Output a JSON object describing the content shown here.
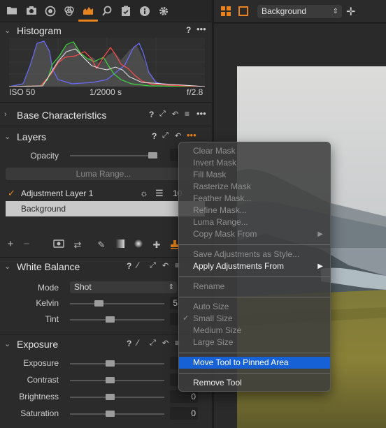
{
  "toolbar": {
    "icons": [
      "folder-icon",
      "camera-icon",
      "lens-icon",
      "color-icon",
      "exposure-icon",
      "details-icon",
      "metadata-icon",
      "info-icon",
      "gear-icon"
    ]
  },
  "histogram": {
    "title": "Histogram",
    "help": "?",
    "more": "•••",
    "iso": "ISO 50",
    "shutter": "1/2000 s",
    "aperture": "f/2.8"
  },
  "base": {
    "title": "Base Characteristics",
    "help": "?"
  },
  "layers": {
    "title": "Layers",
    "help": "?",
    "opacity_label": "Opacity",
    "luma_button": "Luma Range...",
    "adjustment_layer": "Adjustment Layer 1",
    "adjustment_value": "10",
    "background_layer": "Background"
  },
  "white_balance": {
    "title": "White Balance",
    "help": "?",
    "mode_label": "Mode",
    "mode_value": "Shot",
    "kelvin_label": "Kelvin",
    "kelvin_value": "5",
    "tint_label": "Tint",
    "tint_value": "",
    "kelvin_level": 0.3,
    "tint_level": 0.42
  },
  "exposure": {
    "title": "Exposure",
    "help": "?",
    "rows": [
      {
        "label": "Exposure",
        "value": "",
        "level": 0.42
      },
      {
        "label": "Contrast",
        "value": "",
        "level": 0.42
      },
      {
        "label": "Brightness",
        "value": "0",
        "level": 0.42
      },
      {
        "label": "Saturation",
        "value": "0",
        "level": 0.42
      }
    ]
  },
  "viewer": {
    "background_select": "Background"
  },
  "menu": {
    "clear_mask": "Clear Mask",
    "invert_mask": "Invert Mask",
    "fill_mask": "Fill Mask",
    "rasterize_mask": "Rasterize Mask",
    "feather_mask": "Feather Mask...",
    "refine_mask": "Refine Mask...",
    "luma_range": "Luma Range...",
    "copy_mask_from": "Copy Mask From",
    "save_adjustments": "Save Adjustments as Style...",
    "apply_adjustments": "Apply Adjustments From",
    "rename": "Rename",
    "auto_size": "Auto Size",
    "small_size": "Small Size",
    "medium_size": "Medium Size",
    "large_size": "Large Size",
    "move_tool": "Move Tool to Pinned Area",
    "remove_tool": "Remove Tool"
  },
  "colors": {
    "accent": "#e8831e",
    "highlight": "#1761d6"
  }
}
